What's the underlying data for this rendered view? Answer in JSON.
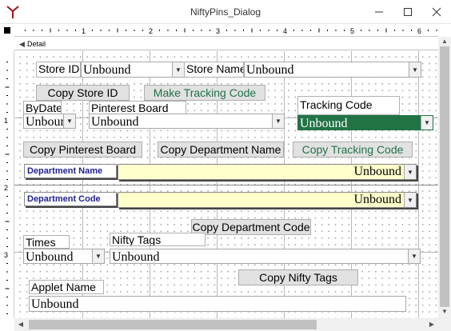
{
  "window": {
    "title": "NiftyPins_Dialog"
  },
  "ruler": {
    "h_marks": [
      "1",
      "2",
      "3",
      "4",
      "5",
      "6"
    ],
    "v_marks": [
      "1",
      "2",
      "3"
    ]
  },
  "section": {
    "label": "Detail"
  },
  "form": {
    "store_id_label": "Store ID",
    "store_id_value": "Unbound",
    "store_name_label": "Store Name",
    "store_name_value": "Unbound",
    "copy_store_id": "Copy Store ID",
    "make_tracking_code": "Make Tracking Code",
    "bydate_label": "ByDate",
    "bydate_value": "Unboun",
    "pinterest_board_label": "Pinterest Board",
    "pinterest_board_value": "Unbound",
    "tracking_code_label": "Tracking Code",
    "tracking_code_value": "Unbound",
    "copy_pinterest_board": "Copy Pinterest Board",
    "copy_department_name": "Copy Department Name",
    "copy_tracking_code": "Copy Tracking Code",
    "department_name_label": "Department Name",
    "department_name_value": "Unbound",
    "department_code_label": "Department Code",
    "department_code_value": "Unbound",
    "copy_department_code": "Copy Department Code",
    "times_label": "Times",
    "times_value": "Unbound",
    "nifty_tags_label": "Nifty Tags",
    "nifty_tags_value": "Unbound",
    "copy_nifty_tags": "Copy Nifty Tags",
    "applet_name_label": "Applet Name",
    "applet_name_value": "Unbound"
  },
  "colors": {
    "accent_green": "#217346",
    "tracking_fill": "#217346",
    "yellow_fill": "#ffffcc",
    "label_navy": "#1f1f8f"
  }
}
